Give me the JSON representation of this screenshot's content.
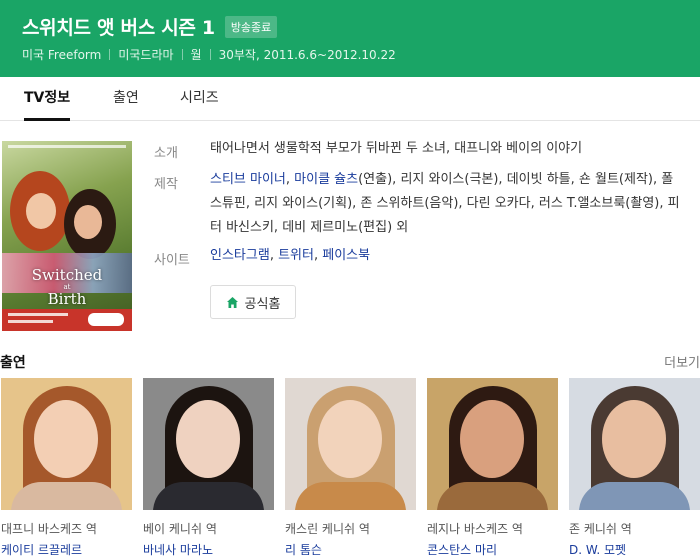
{
  "show": {
    "title": "스위치드 앳 버스 시즌 1",
    "status": "방송종료",
    "meta": [
      "미국 Freeform",
      "미국드라마",
      "월",
      "30부작, 2011.6.6~2012.10.22"
    ]
  },
  "tabs": [
    {
      "label": "TV정보",
      "active": true
    },
    {
      "label": "출연",
      "active": false
    },
    {
      "label": "시리즈",
      "active": false
    }
  ],
  "poster": {
    "title": "Switched at Birth",
    "title_line1": "Switched",
    "title_line2": "at",
    "title_line3": "Birth"
  },
  "info": {
    "synopsis_label": "소개",
    "synopsis": "태어나면서 생물학적 부모가 뒤바뀐 두 소녀, 대프니와 베이의 이야기",
    "production_label": "제작",
    "production": [
      {
        "name": "스티브 마이너",
        "link": true
      },
      {
        "name": ", ",
        "link": false
      },
      {
        "name": "마이클 슐츠",
        "link": true
      },
      {
        "name": "(연출), 리지 와이스(극본), 데이빗 하틀, 숀 월트(제작), 폴 스튜핀, 리지 와이스(기획), 존 스위하트(음악), 다린 오카다, 러스 T.앨소브룩(촬영), 피터 바신스키, 데비 제르미노(편집) 외",
        "link": false
      }
    ],
    "site_label": "사이트",
    "sites": [
      "인스타그램",
      "트위터",
      "페이스북"
    ],
    "homepage_label": "공식홈"
  },
  "cast": {
    "title": "출연",
    "more_label": "더보기",
    "members": [
      {
        "role": "대프니 바스케즈 역",
        "actor": "케이티 르끌레르",
        "bg": "#e6c48a",
        "hair": "#a5582b",
        "skin": "#f3cfb4",
        "body": "#d9b9a0"
      },
      {
        "role": "베이 케니쉬 역",
        "actor": "바네사 마라노",
        "bg": "#8a8a8a",
        "hair": "#1c1410",
        "skin": "#efd2c0",
        "body": "#2a2a30"
      },
      {
        "role": "캐스린 케니쉬 역",
        "actor": "리 톰슨",
        "bg": "#e0d8d2",
        "hair": "#caa070",
        "skin": "#f2d3bb",
        "body": "#c88a4a"
      },
      {
        "role": "레지나 바스케즈 역",
        "actor": "콘스탄스 마리",
        "bg": "#c8a468",
        "hair": "#2e1a12",
        "skin": "#d9a07e",
        "body": "#9a6a3c"
      },
      {
        "role": "존 케니쉬 역",
        "actor": "D. W. 모펫",
        "bg": "#d6dbe2",
        "hair": "#4a3a32",
        "skin": "#e8bea0",
        "body": "#7f96b6"
      }
    ]
  },
  "colors": {
    "brand": "#1aa566",
    "link": "#1a3c9c"
  }
}
